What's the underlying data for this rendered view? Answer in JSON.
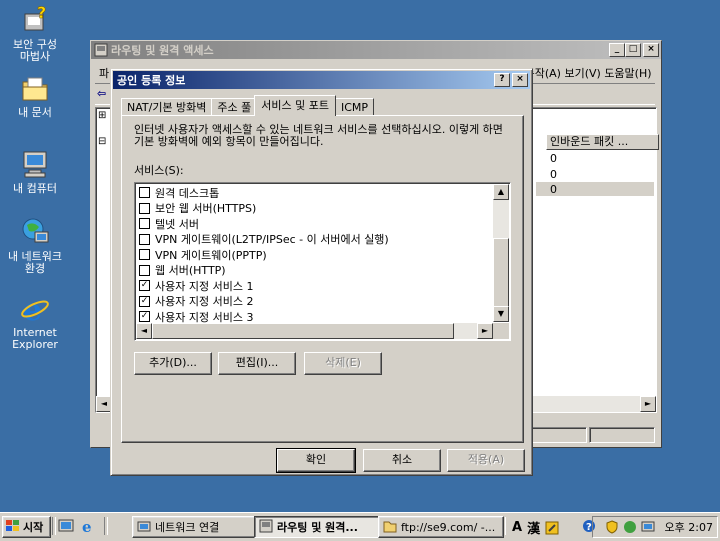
{
  "desktop": {
    "icons": [
      {
        "label": "보안 구성\n마법사",
        "icon": "security-wizard-icon"
      },
      {
        "label": "내 문서",
        "icon": "my-documents-icon"
      },
      {
        "label": "내 컴퓨터",
        "icon": "my-computer-icon"
      },
      {
        "label": "내 네트워크\n환경",
        "icon": "my-network-icon"
      },
      {
        "label": "Internet\nExplorer",
        "icon": "internet-explorer-icon"
      }
    ]
  },
  "bg_window": {
    "title": "라우팅 및 원격 액세스",
    "menu_partial": "파",
    "menu_row": "동작(A)   보기(V)   도움말(H)",
    "column_header": "인바운드 패킷 ...",
    "rows": [
      "0",
      "0",
      "0"
    ]
  },
  "dialog": {
    "title": "공인 등록 정보",
    "help_btn": "?",
    "close_btn": "×",
    "tabs": [
      "NAT/기본 방화벽",
      "주소 풀",
      "서비스 및 포트",
      "ICMP"
    ],
    "active_tab": "서비스 및 포트",
    "description": "인터넷 사용자가 액세스할 수 있는 네트워크 서비스를 선택하십시오. 이렇게 하면 기본 방화벽에 예외 항목이 만들어집니다.",
    "services_label": "서비스(S):",
    "services": [
      {
        "label": "원격 데스크톱",
        "checked": false
      },
      {
        "label": "보안 웹 서버(HTTPS)",
        "checked": false
      },
      {
        "label": "텔넷 서버",
        "checked": false
      },
      {
        "label": "VPN 게이트웨이(L2TP/IPSec - 이 서버에서 실행)",
        "checked": false
      },
      {
        "label": "VPN 게이트웨이(PPTP)",
        "checked": false
      },
      {
        "label": "웹 서버(HTTP)",
        "checked": false
      },
      {
        "label": "사용자 지정 서비스 1",
        "checked": true
      },
      {
        "label": "사용자 지정 서비스 2",
        "checked": true
      },
      {
        "label": "사용자 지정 서비스 3",
        "checked": true
      }
    ],
    "buttons": {
      "add": "추가(D)...",
      "edit": "편집(I)...",
      "delete": "삭제(E)",
      "ok": "확인",
      "cancel": "취소",
      "apply": "적용(A)"
    }
  },
  "taskbar": {
    "start": "시작",
    "tasks": [
      {
        "label": "네트워크 연결",
        "active": false
      },
      {
        "label": "라우팅 및 원격...",
        "active": true
      },
      {
        "label": "ftp://se9.com/ -...",
        "active": false
      }
    ],
    "lang_a": "A",
    "lang_han": "漢",
    "clock": "오후 2:07"
  },
  "colors": {
    "desktop": "#3a6ea5",
    "title_active_start": "#0a246a",
    "title_active_end": "#a6caf0",
    "face": "#d4d0c8"
  }
}
